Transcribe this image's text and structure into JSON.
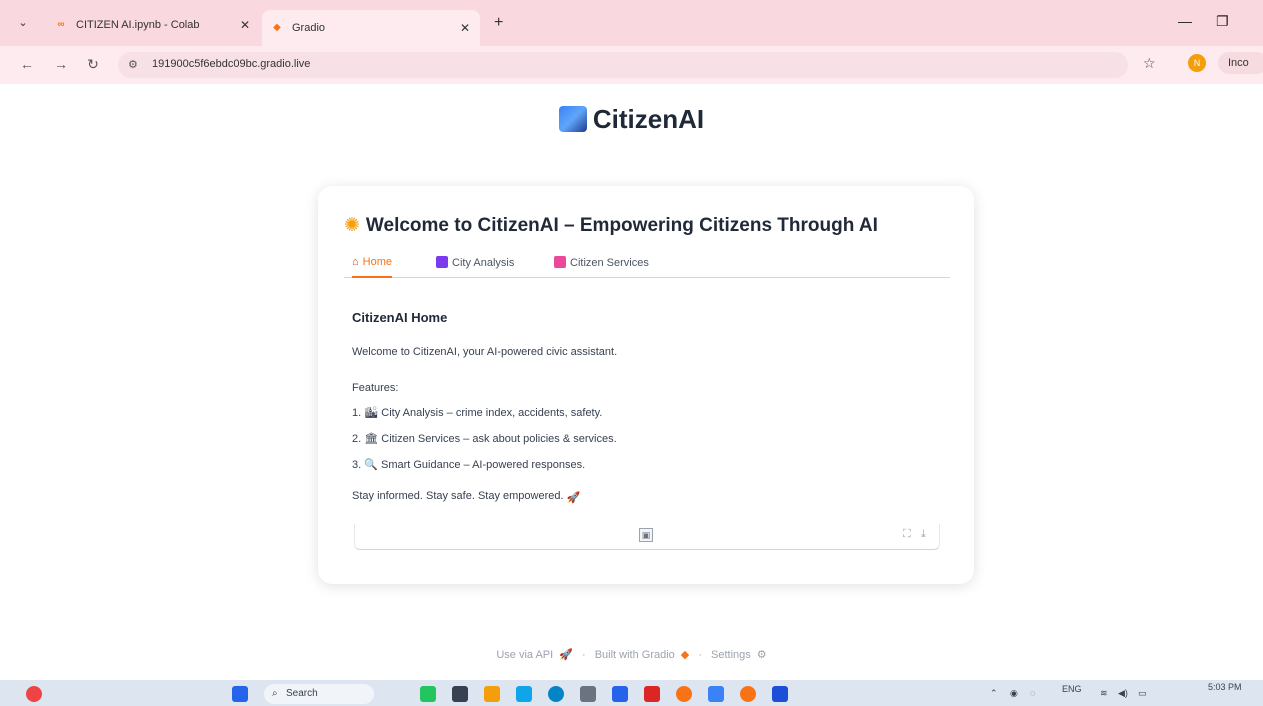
{
  "browser": {
    "tabs": [
      {
        "title": "CITIZEN AI.ipynb - Colab",
        "favicon": "colab-icon",
        "active": false
      },
      {
        "title": "Gradio",
        "favicon": "gradio-icon",
        "active": true
      }
    ],
    "url": "191900c5f6ebdc09bc.gradio.live",
    "profile_initial": "N",
    "profile_label": "Inco"
  },
  "app": {
    "title": "CitizenAI",
    "welcome": "Welcome to CitizenAI – Empowering Citizens Through AI",
    "tabs": [
      {
        "label": "Home",
        "icon": "home-icon",
        "active": true
      },
      {
        "label": "City Analysis",
        "icon": "city-icon",
        "active": false
      },
      {
        "label": "Citizen Services",
        "icon": "services-icon",
        "active": false
      }
    ],
    "home": {
      "heading": "CitizenAI Home",
      "intro": "Welcome to CitizenAI, your AI-powered civic assistant.",
      "features_label": "Features:",
      "features": [
        "1. 🏙 City Analysis – crime index, accidents, safety.",
        "2. 🏛 Citizen Services – ask about policies & services.",
        "3. 🔍 Smart Guidance – AI-powered responses."
      ],
      "tagline": "Stay informed. Stay safe. Stay empowered."
    }
  },
  "footer": {
    "api": "Use via API",
    "built": "Built with Gradio",
    "settings": "Settings"
  },
  "taskbar": {
    "search_placeholder": "Search",
    "lang": "ENG",
    "time": "5:03 PM"
  }
}
